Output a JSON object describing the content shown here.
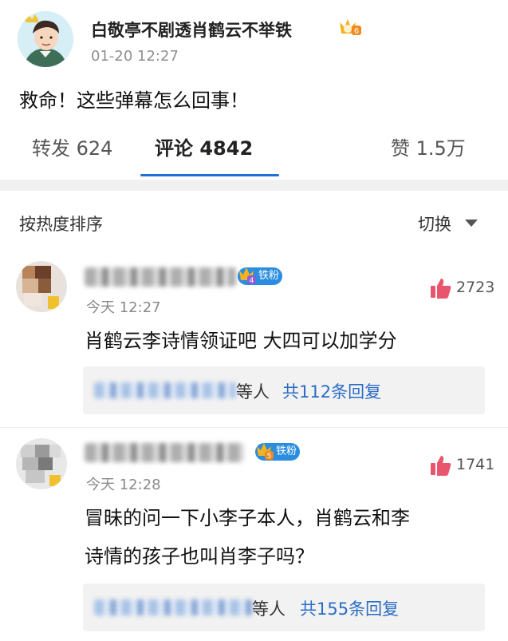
{
  "post": {
    "author": "白敬亭不剧透肖鹤云不举铁",
    "badge_level": "6",
    "time": "01-20 12:27",
    "text": "救命！这些弹幕怎么回事！"
  },
  "tabs": {
    "repost": "转发 624",
    "comment": "评论 4842",
    "like": "赞 1.5万"
  },
  "sort": {
    "label": "按热度排序",
    "switch": "切换"
  },
  "comments": [
    {
      "badge_level": "4",
      "badge_text": "铁粉",
      "time": "今天 12:27",
      "likes": "2723",
      "text_lines": [
        "肖鹤云李诗情领证吧  大四可以加学分"
      ],
      "reply_etc": "等人",
      "reply_count": "共112条回复"
    },
    {
      "badge_level": "5",
      "badge_text": "铁粉",
      "time": "今天 12:28",
      "likes": "1741",
      "text_lines": [
        "冒昧的问一下小李子本人，肖鹤云和李",
        "诗情的孩子也叫肖李子吗？"
      ],
      "reply_etc": "等人",
      "reply_count": "共155条回复"
    }
  ],
  "colors": {
    "accent": "#1e6fd0",
    "link": "#2b6cc6",
    "like_icon": "#e8556c",
    "badge": "#2a8de0",
    "crown": "#f3b21f"
  }
}
